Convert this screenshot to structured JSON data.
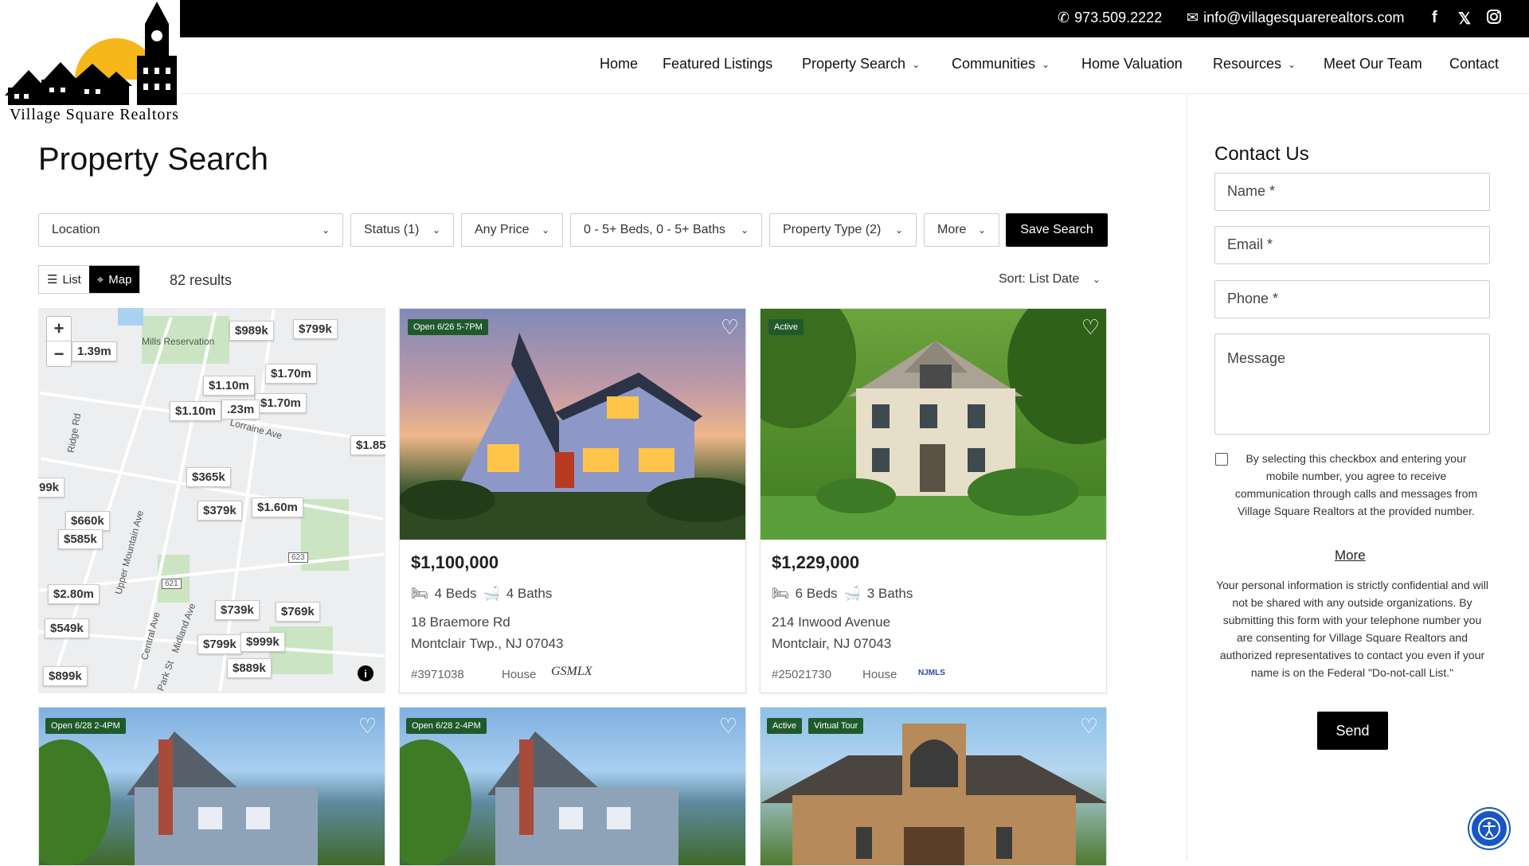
{
  "topbar": {
    "phone": "973.509.2222",
    "email": "info@villagesquarerealtors.com",
    "social": [
      "facebook-icon",
      "x-icon",
      "instagram-icon"
    ]
  },
  "logo": {
    "text": "Village Square Realtors"
  },
  "nav": {
    "items": [
      {
        "label": "Home"
      },
      {
        "label": "Featured Listings"
      },
      {
        "label": "Property Search",
        "dropdown": true
      },
      {
        "label": "Communities",
        "dropdown": true
      },
      {
        "label": "Home Valuation"
      },
      {
        "label": "Resources",
        "dropdown": true
      },
      {
        "label": "Meet Our Team"
      },
      {
        "label": "Contact"
      }
    ]
  },
  "page": {
    "title": "Property Search"
  },
  "filters": {
    "location": "Location",
    "status": "Status (1)",
    "price": "Any Price",
    "beds_baths": "0 - 5+ Beds, 0 - 5+ Baths",
    "property_type": "Property Type (2)",
    "more": "More",
    "save": "Save Search"
  },
  "view": {
    "list": "List",
    "map": "Map",
    "active": "Map",
    "results": "82 results",
    "sort": "Sort: List Date"
  },
  "map": {
    "labels": [
      "Mills Reservation",
      "Lorraine Ave",
      "Ridge Rd",
      "Upper Mountain Ave",
      "Central Ave",
      "Midland Ave",
      "Park St"
    ],
    "road_badges": [
      "623",
      "621"
    ],
    "prices": [
      "$989k",
      "$799k",
      "1.39m",
      "$1.70m",
      "$1.10m",
      "$1.70m",
      "$1.10m",
      ".23m",
      "$1.85",
      "$365k",
      "99k",
      "$379k",
      "$1.60m",
      "$660k",
      "$585k",
      "$2.80m",
      "$739k",
      "$769k",
      "$549k",
      "$799k",
      "$999k",
      "$889k",
      "$899k"
    ]
  },
  "listings": [
    {
      "badges": [
        "Open 6/26 5-7PM"
      ],
      "price": "$1,100,000",
      "beds": "4 Beds",
      "baths": "4 Baths",
      "street": "18 Braemore Rd",
      "city": "Montclair Twp., NJ 07043",
      "mls": "#3971038",
      "type": "House",
      "source": "GSMLX"
    },
    {
      "badges": [
        "Active"
      ],
      "price": "$1,229,000",
      "beds": "6 Beds",
      "baths": "3 Baths",
      "street": "214 Inwood Avenue",
      "city": "Montclair, NJ 07043",
      "mls": "#25021730",
      "type": "House",
      "source": "NJMLS"
    },
    {
      "badges": [
        "Open 6/28 2-4PM"
      ]
    },
    {
      "badges": [
        "Open 6/28 2-4PM"
      ]
    },
    {
      "badges": [
        "Active",
        "Virtual Tour"
      ]
    }
  ],
  "contact": {
    "title": "Contact Us",
    "name": "Name *",
    "email": "Email *",
    "phone": "Phone *",
    "message": "Message",
    "consent": "By selecting this checkbox and entering your mobile number, you agree to receive communication through calls and messages from Village Square Realtors at the provided number.",
    "more": "More",
    "privacy": "Your personal information is strictly confidential and will not be shared with any outside organizations. By submitting this form with your telephone number you are consenting for Village Square Realtors and authorized representatives to contact you even if your name is on the Federal \"Do-not-call List.\"",
    "send": "Send"
  },
  "colors": {
    "badge": "#1f5a2b",
    "accent": "#000000",
    "a11y": "#1756c8"
  }
}
